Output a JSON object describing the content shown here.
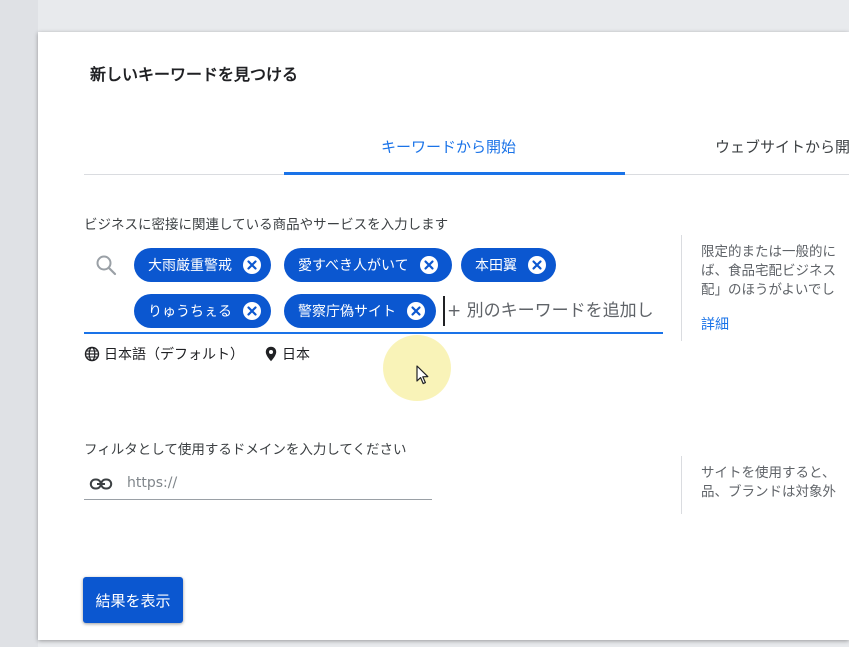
{
  "dialog": {
    "title": "新しいキーワードを見つける"
  },
  "tabs": [
    {
      "label": "キーワードから開始",
      "active": true
    },
    {
      "label": "ウェブサイトから開始",
      "active": false
    }
  ],
  "keywords_section": {
    "label": "ビジネスに密接に関連している商品やサービスを入力します",
    "chips": [
      {
        "text": "大雨厳重警戒"
      },
      {
        "text": "愛すべき人がいて"
      },
      {
        "text": "本田翼"
      },
      {
        "text": "りゅうちぇる"
      },
      {
        "text": "警察庁偽サイト"
      }
    ],
    "input_placeholder": "+ 別のキーワードを追加し",
    "language": "日本語（デフォルト）",
    "location": "日本",
    "help_text": [
      "限定的または一般的に",
      "ば、食品宅配ビジネス",
      "配」のほうがよいでし"
    ],
    "help_link": "詳細"
  },
  "domain_section": {
    "label": "フィルタとして使用するドメインを入力してください",
    "input_placeholder": "https://",
    "help_text": [
      "サイトを使用すると、",
      "品、ブランドは対象外"
    ]
  },
  "actions": {
    "show_results_label": "結果を表示"
  },
  "colors": {
    "accent": "#1a73e8",
    "chip": "#0b57d0",
    "button": "#0b57d0"
  },
  "icons": {
    "search": "search-icon",
    "chip_remove": "close-circle-icon",
    "language": "globe-icon",
    "location": "location-pin-icon",
    "domain": "link-icon",
    "cursor": "mouse-pointer-icon"
  }
}
